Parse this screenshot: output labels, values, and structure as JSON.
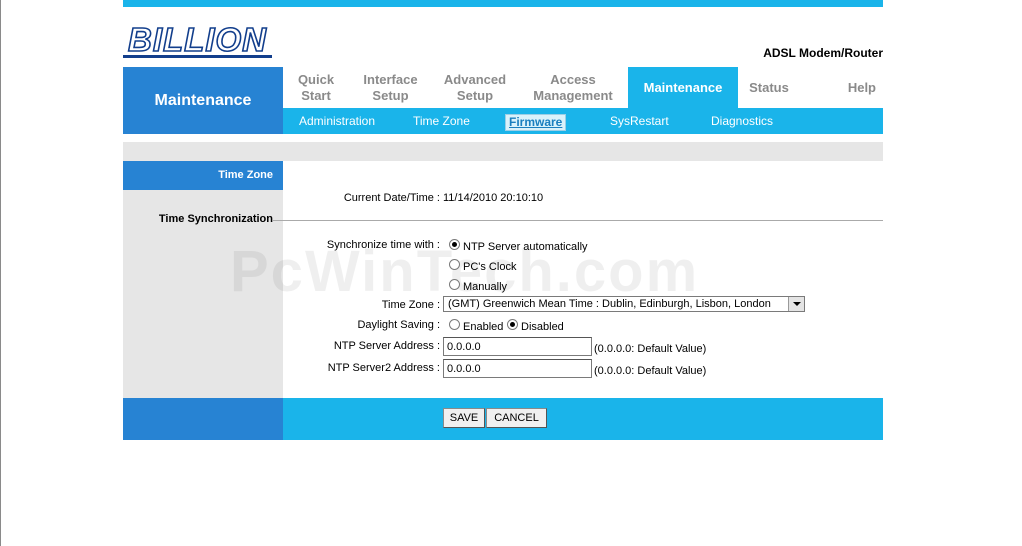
{
  "header": {
    "logo_text": "BILLION",
    "product_title": "ADSL Modem/Router",
    "section_title": "Maintenance"
  },
  "nav": {
    "items": [
      {
        "label": "Quick\nStart",
        "active": false
      },
      {
        "label": "Interface\nSetup",
        "active": false
      },
      {
        "label": "Advanced\nSetup",
        "active": false
      },
      {
        "label": "Access\nManagement",
        "active": false
      },
      {
        "label": "Maintenance",
        "active": true
      },
      {
        "label": "Status",
        "active": false
      },
      {
        "label": "Help",
        "active": false
      }
    ]
  },
  "subnav": {
    "items": [
      {
        "label": "Administration",
        "active": false
      },
      {
        "label": "Time Zone",
        "active": false
      },
      {
        "label": "Firmware",
        "active": true
      },
      {
        "label": "SysRestart",
        "active": false
      },
      {
        "label": "Diagnostics",
        "active": false
      }
    ]
  },
  "sidebar": {
    "active_item": "Time Zone",
    "section_label": "Time Synchronization"
  },
  "form": {
    "current_datetime_label": "Current Date/Time :",
    "current_datetime_value": "11/14/2010 20:10:10",
    "sync_label": "Synchronize time with :",
    "sync_options": [
      {
        "label": "NTP Server automatically",
        "checked": true
      },
      {
        "label": "PC's Clock",
        "checked": false
      },
      {
        "label": "Manually",
        "checked": false
      }
    ],
    "timezone_label": "Time Zone :",
    "timezone_value": "(GMT) Greenwich Mean Time : Dublin, Edinburgh, Lisbon, London",
    "daylight_label": "Daylight Saving :",
    "daylight_options": [
      {
        "label": "Enabled",
        "checked": false
      },
      {
        "label": "Disabled",
        "checked": true
      }
    ],
    "ntp1_label": "NTP Server Address :",
    "ntp1_value": "0.0.0.0",
    "ntp1_hint": "(0.0.0.0: Default Value)",
    "ntp2_label": "NTP Server2 Address :",
    "ntp2_value": "0.0.0.0",
    "ntp2_hint": "(0.0.0.0: Default Value)"
  },
  "buttons": {
    "save": "SAVE",
    "cancel": "CANCEL"
  },
  "watermark": "PcWinTech.com",
  "colors": {
    "accent_cyan": "#1ab4ea",
    "accent_blue": "#2783d3",
    "panel_gray": "#e6e6e6",
    "logo_blue": "#123e8c"
  }
}
